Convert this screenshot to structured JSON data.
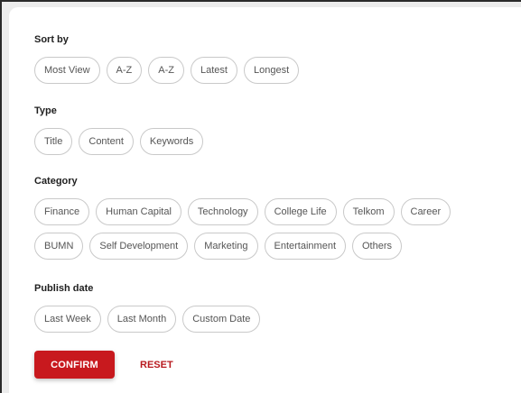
{
  "sort_by": {
    "title": "Sort by",
    "options": [
      "Most View",
      "A-Z",
      "A-Z",
      "Latest",
      "Longest"
    ]
  },
  "type": {
    "title": "Type",
    "options": [
      "Title",
      "Content",
      "Keywords"
    ]
  },
  "category": {
    "title": "Category",
    "options_row1": [
      "Finance",
      "Human Capital",
      "Technology",
      "College Life",
      "Telkom",
      "Career"
    ],
    "options_row2": [
      "BUMN",
      "Self Development",
      "Marketing",
      "Entertainment",
      "Others"
    ]
  },
  "publish_date": {
    "title": "Publish date",
    "options": [
      "Last Week",
      "Last Month",
      "Custom Date"
    ]
  },
  "actions": {
    "confirm_label": "CONFIRM",
    "reset_label": "RESET"
  },
  "colors": {
    "accent": "#c8191e",
    "chip_border": "#c9c9c9"
  }
}
